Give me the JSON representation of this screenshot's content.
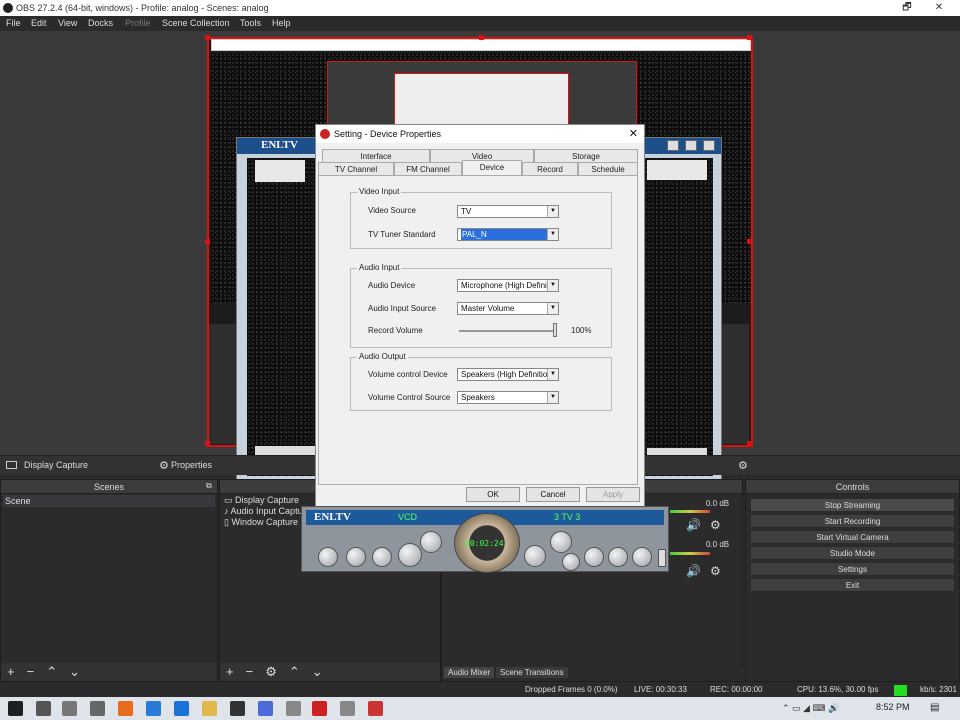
{
  "window": {
    "title": "OBS 27.2.4 (64-bit, windows) - Profile: analog - Scenes: analog",
    "restore": "🗗",
    "close": "✕"
  },
  "menu": [
    "File",
    "Edit",
    "View",
    "Docks",
    "Profile",
    "Scene Collection",
    "Tools",
    "Help"
  ],
  "source_toolbar": {
    "source_name": "Display Capture",
    "properties": "Properties"
  },
  "scenes": {
    "title": "Scenes",
    "items": [
      "Scene"
    ]
  },
  "sources": {
    "items": [
      "Display Capture",
      "Audio Input Capture",
      "Window Capture"
    ]
  },
  "mixer": {
    "level1": "0.0 dB",
    "level2": "0.0 dB",
    "tabs": [
      "Audio Mixer",
      "Scene Transitions"
    ]
  },
  "controls": {
    "title": "Controls",
    "buttons": [
      "Stop Streaming",
      "Start Recording",
      "Start Virtual Camera",
      "Studio Mode",
      "Settings",
      "Exit"
    ]
  },
  "status": {
    "dropped": "Dropped Frames 0 (0.0%)",
    "live": "LIVE: 00:30:33",
    "rec": "REC: 00:00:00",
    "cpu": "CPU: 13.6%, 30.00 fps",
    "kbps": "kb/s: 2301"
  },
  "dialog": {
    "title": "Setting - Device Properties",
    "tabs_row1": [
      "Interface",
      "Video",
      "Storage"
    ],
    "tabs_row2": [
      "TV Channel",
      "FM Channel",
      "Device",
      "Record",
      "Schedule"
    ],
    "video_input": {
      "label": "Video Input",
      "video_source_label": "Video Source",
      "video_source_value": "TV",
      "tv_tuner_label": "TV Tuner Standard",
      "tv_tuner_value": "PAL_N"
    },
    "audio_input": {
      "label": "Audio Input",
      "audio_device_label": "Audio Device",
      "audio_device_value": "Microphone (High Defini",
      "audio_source_label": "Audio Input Source",
      "audio_source_value": "Master Volume",
      "record_volume_label": "Record Volume",
      "record_volume_value": "100%",
      "record_volume_level": 1.0
    },
    "audio_output": {
      "label": "Audio Output",
      "volume_device_label": "Volume control Device",
      "volume_device_value": "Speakers (High Definitio",
      "volume_source_label": "Volume Control Source",
      "volume_source_value": "Speakers"
    },
    "ok": "OK",
    "cancel": "Cancel",
    "apply": "Apply"
  },
  "player": {
    "brand": "ENLTV",
    "mode": "VCD",
    "channel": "3 TV 3",
    "time": "00:02:24"
  },
  "tv_window": {
    "brand": "ENLTV"
  },
  "taskbar": {
    "time": "8:52 PM"
  },
  "colors": {
    "selection_red": "#dd1111",
    "status_green": "#22dd22",
    "player_time_green": "#44ff44"
  }
}
